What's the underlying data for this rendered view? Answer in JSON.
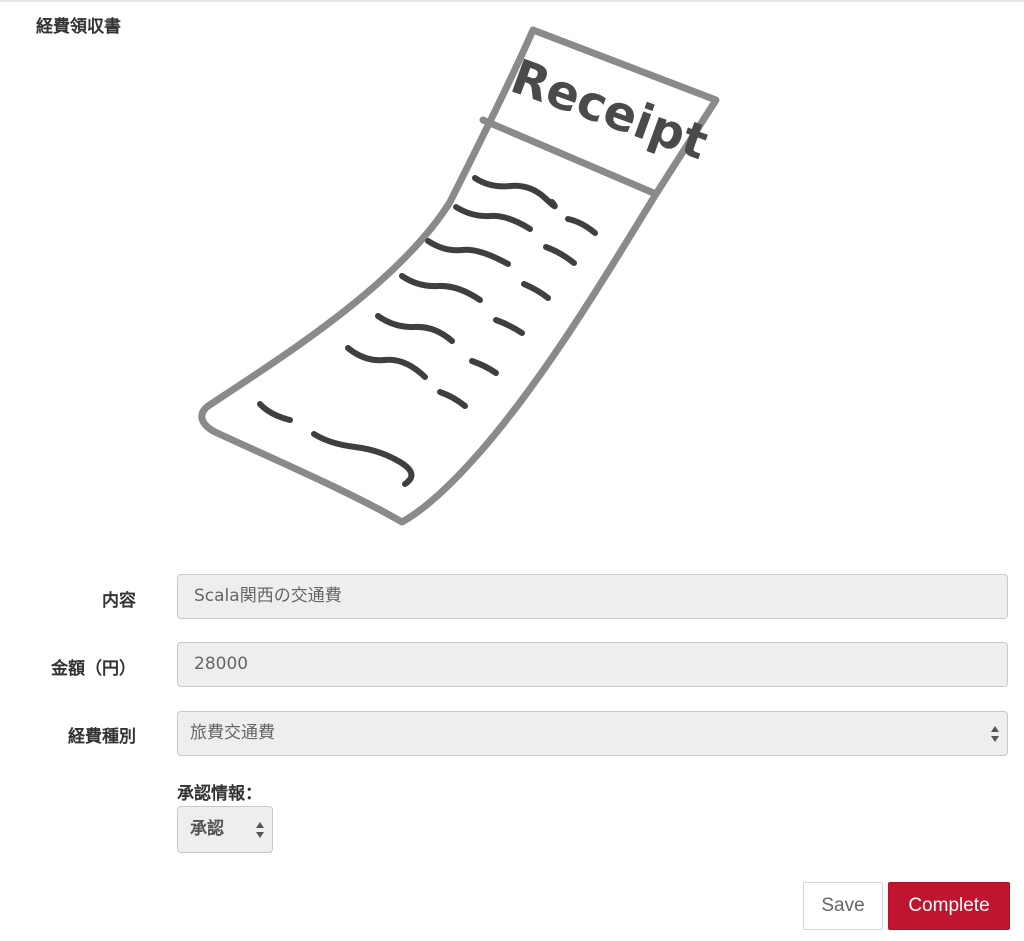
{
  "section": {
    "title": "経費領収書"
  },
  "receipt_image": {
    "text": "Receipt"
  },
  "form": {
    "content": {
      "label": "内容",
      "value": "Scala関西の交通費"
    },
    "amount": {
      "label": "金額（円）",
      "value": "28000"
    },
    "expense_type": {
      "label": "経費種別",
      "value": "旅費交通費"
    },
    "approval": {
      "label": "承認情報：",
      "value": "承認"
    }
  },
  "actions": {
    "save_label": "Save",
    "complete_label": "Complete"
  },
  "colors": {
    "primary": "#c0152f",
    "field_bg": "#eeeeee",
    "border": "#c9c9c9"
  }
}
